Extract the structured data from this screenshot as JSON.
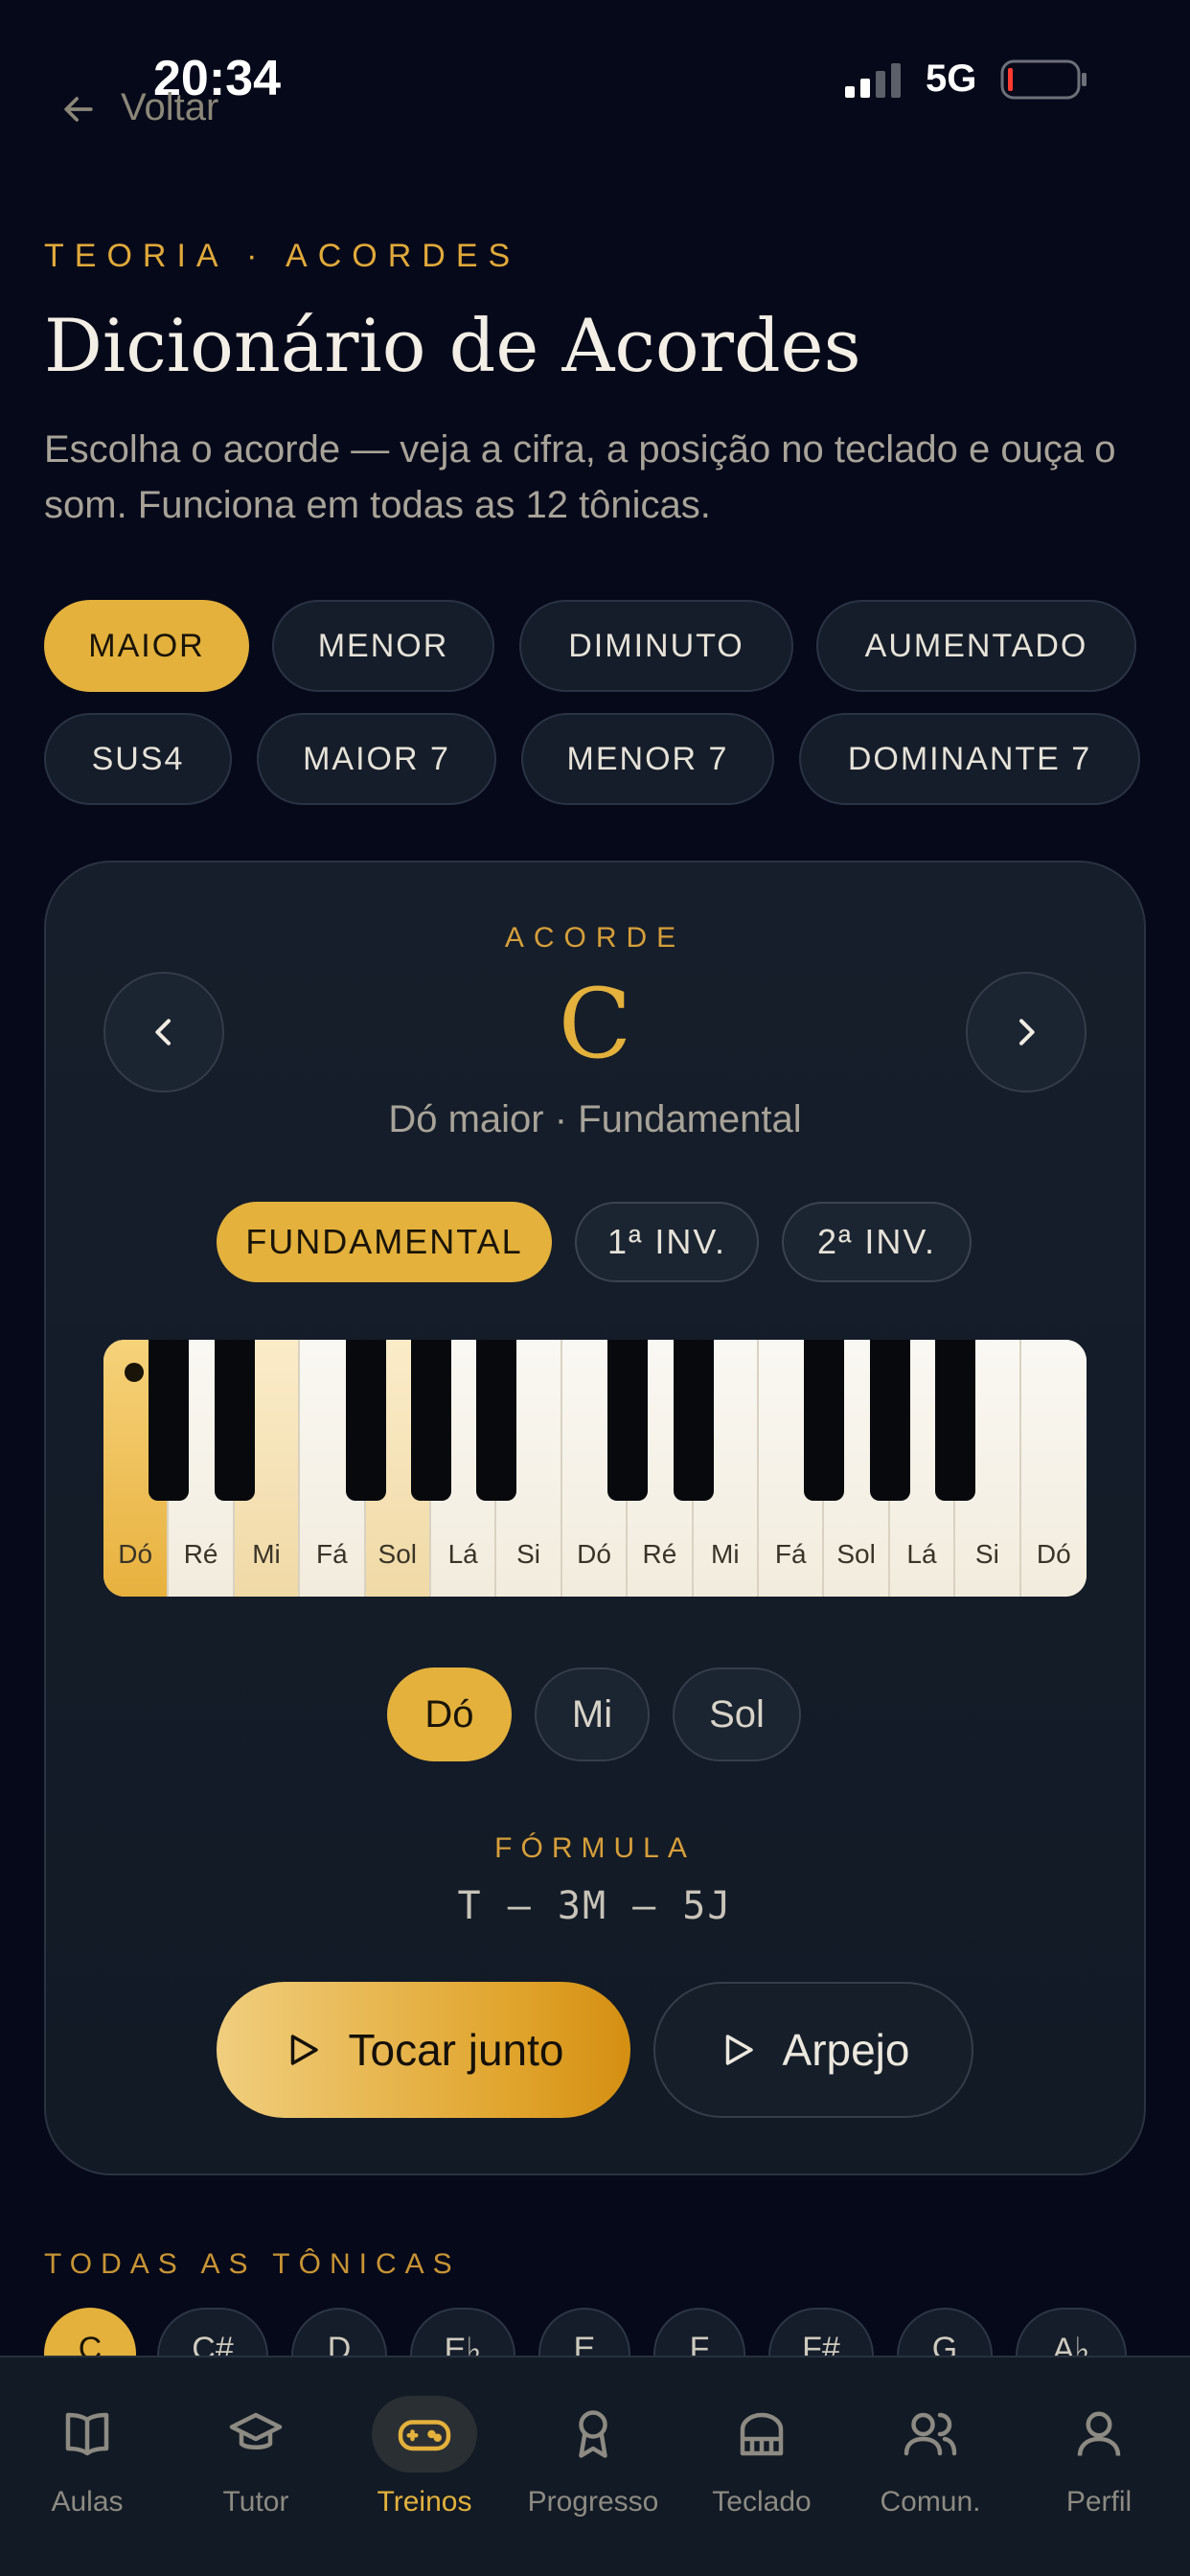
{
  "status": {
    "time": "20:34",
    "network": "5G"
  },
  "nav": {
    "back_label": "Voltar"
  },
  "header": {
    "eyebrow": "TEORIA · ACORDES",
    "title": "Dicionário de Acordes",
    "subtitle": "Escolha o acorde — veja a cifra, a posição no teclado e ouça o som. Funciona em todas as 12 tônicas."
  },
  "chord_types": [
    {
      "label": "MAIOR",
      "active": true
    },
    {
      "label": "MENOR",
      "active": false
    },
    {
      "label": "DIMINUTO",
      "active": false
    },
    {
      "label": "AUMENTADO",
      "active": false
    },
    {
      "label": "SUS4",
      "active": false
    },
    {
      "label": "MAIOR 7",
      "active": false
    },
    {
      "label": "MENOR 7",
      "active": false
    },
    {
      "label": "DOMINANTE 7",
      "active": false
    }
  ],
  "card": {
    "eyebrow": "ACORDE",
    "chord_symbol": "C",
    "description": "Dó maior · Fundamental",
    "inversions": [
      {
        "label": "FUNDAMENTAL",
        "active": true
      },
      {
        "label": "1ª INV.",
        "active": false
      },
      {
        "label": "2ª INV.",
        "active": false
      }
    ],
    "keyboard": {
      "white_keys": [
        "Dó",
        "Ré",
        "Mi",
        "Fá",
        "Sol",
        "Lá",
        "Si",
        "Dó",
        "Ré",
        "Mi",
        "Fá",
        "Sol",
        "Lá",
        "Si",
        "Dó"
      ],
      "highlighted": [
        0,
        2,
        4
      ]
    },
    "notes": [
      {
        "label": "Dó",
        "active": true
      },
      {
        "label": "Mi",
        "active": false
      },
      {
        "label": "Sol",
        "active": false
      }
    ],
    "formula_label": "FÓRMULA",
    "formula": "T – 3M – 5J",
    "play_together": "Tocar junto",
    "arpeggio": "Arpejo"
  },
  "tonics": {
    "label": "TODAS AS TÔNICAS",
    "items": [
      "C",
      "C#",
      "D",
      "E♭",
      "E",
      "F",
      "F#",
      "G",
      "A♭"
    ],
    "active_index": 0
  },
  "tabbar": [
    {
      "label": "Aulas",
      "icon": "book-icon",
      "active": false
    },
    {
      "label": "Tutor",
      "icon": "graduation-cap-icon",
      "active": false
    },
    {
      "label": "Treinos",
      "icon": "gamepad-icon",
      "active": true
    },
    {
      "label": "Progresso",
      "icon": "award-icon",
      "active": false
    },
    {
      "label": "Teclado",
      "icon": "piano-icon",
      "active": false
    },
    {
      "label": "Comun.",
      "icon": "users-icon",
      "active": false
    },
    {
      "label": "Perfil",
      "icon": "user-icon",
      "active": false
    }
  ],
  "colors": {
    "accent": "#e3b13c",
    "background": "#06091a",
    "card": "#161e2b"
  }
}
